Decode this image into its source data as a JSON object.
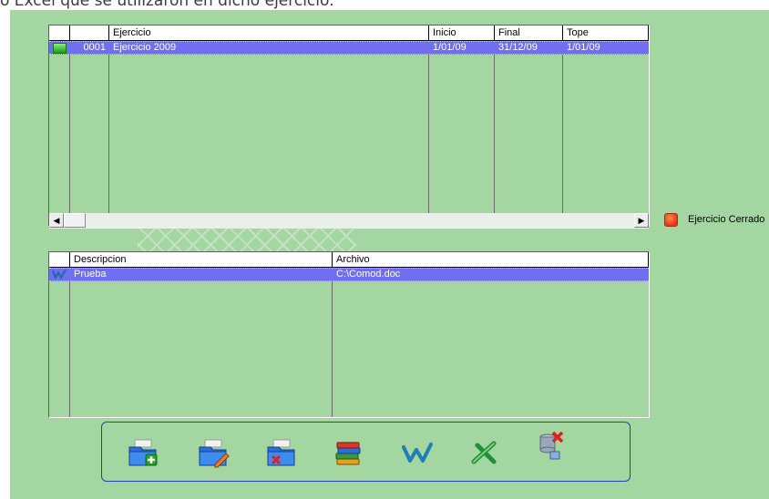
{
  "caption": "o Excel que se utilizaron en dicho ejercicio.",
  "ejercicios_grid": {
    "columns": [
      "",
      "",
      "Ejercicio",
      "Inicio",
      "Final",
      "Tope"
    ],
    "rows": [
      {
        "status": "open",
        "codigo": "0001",
        "ejercicio": "Ejercicio 2009",
        "inicio": "1/01/09",
        "final": "31/12/09",
        "tope": "1/01/09"
      }
    ]
  },
  "legend": {
    "label": "Ejercicio Cerrado",
    "color": "#e03a1a"
  },
  "documentos_grid": {
    "columns": [
      "",
      "Descripcion",
      "Archivo"
    ],
    "rows": [
      {
        "icon": "word-icon",
        "descripcion": "Prueba",
        "archivo": "C:\\Comod.doc"
      }
    ]
  },
  "toolbar": {
    "buttons": [
      "add-folder-icon",
      "edit-folder-icon",
      "delete-folder-icon",
      "books-icon",
      "word-icon",
      "excel-icon",
      "delete-database-icon"
    ]
  },
  "colors": {
    "background": "#a3d6a0",
    "selection": "#6f6ff0",
    "toolbar_border": "#2a3fb0"
  }
}
